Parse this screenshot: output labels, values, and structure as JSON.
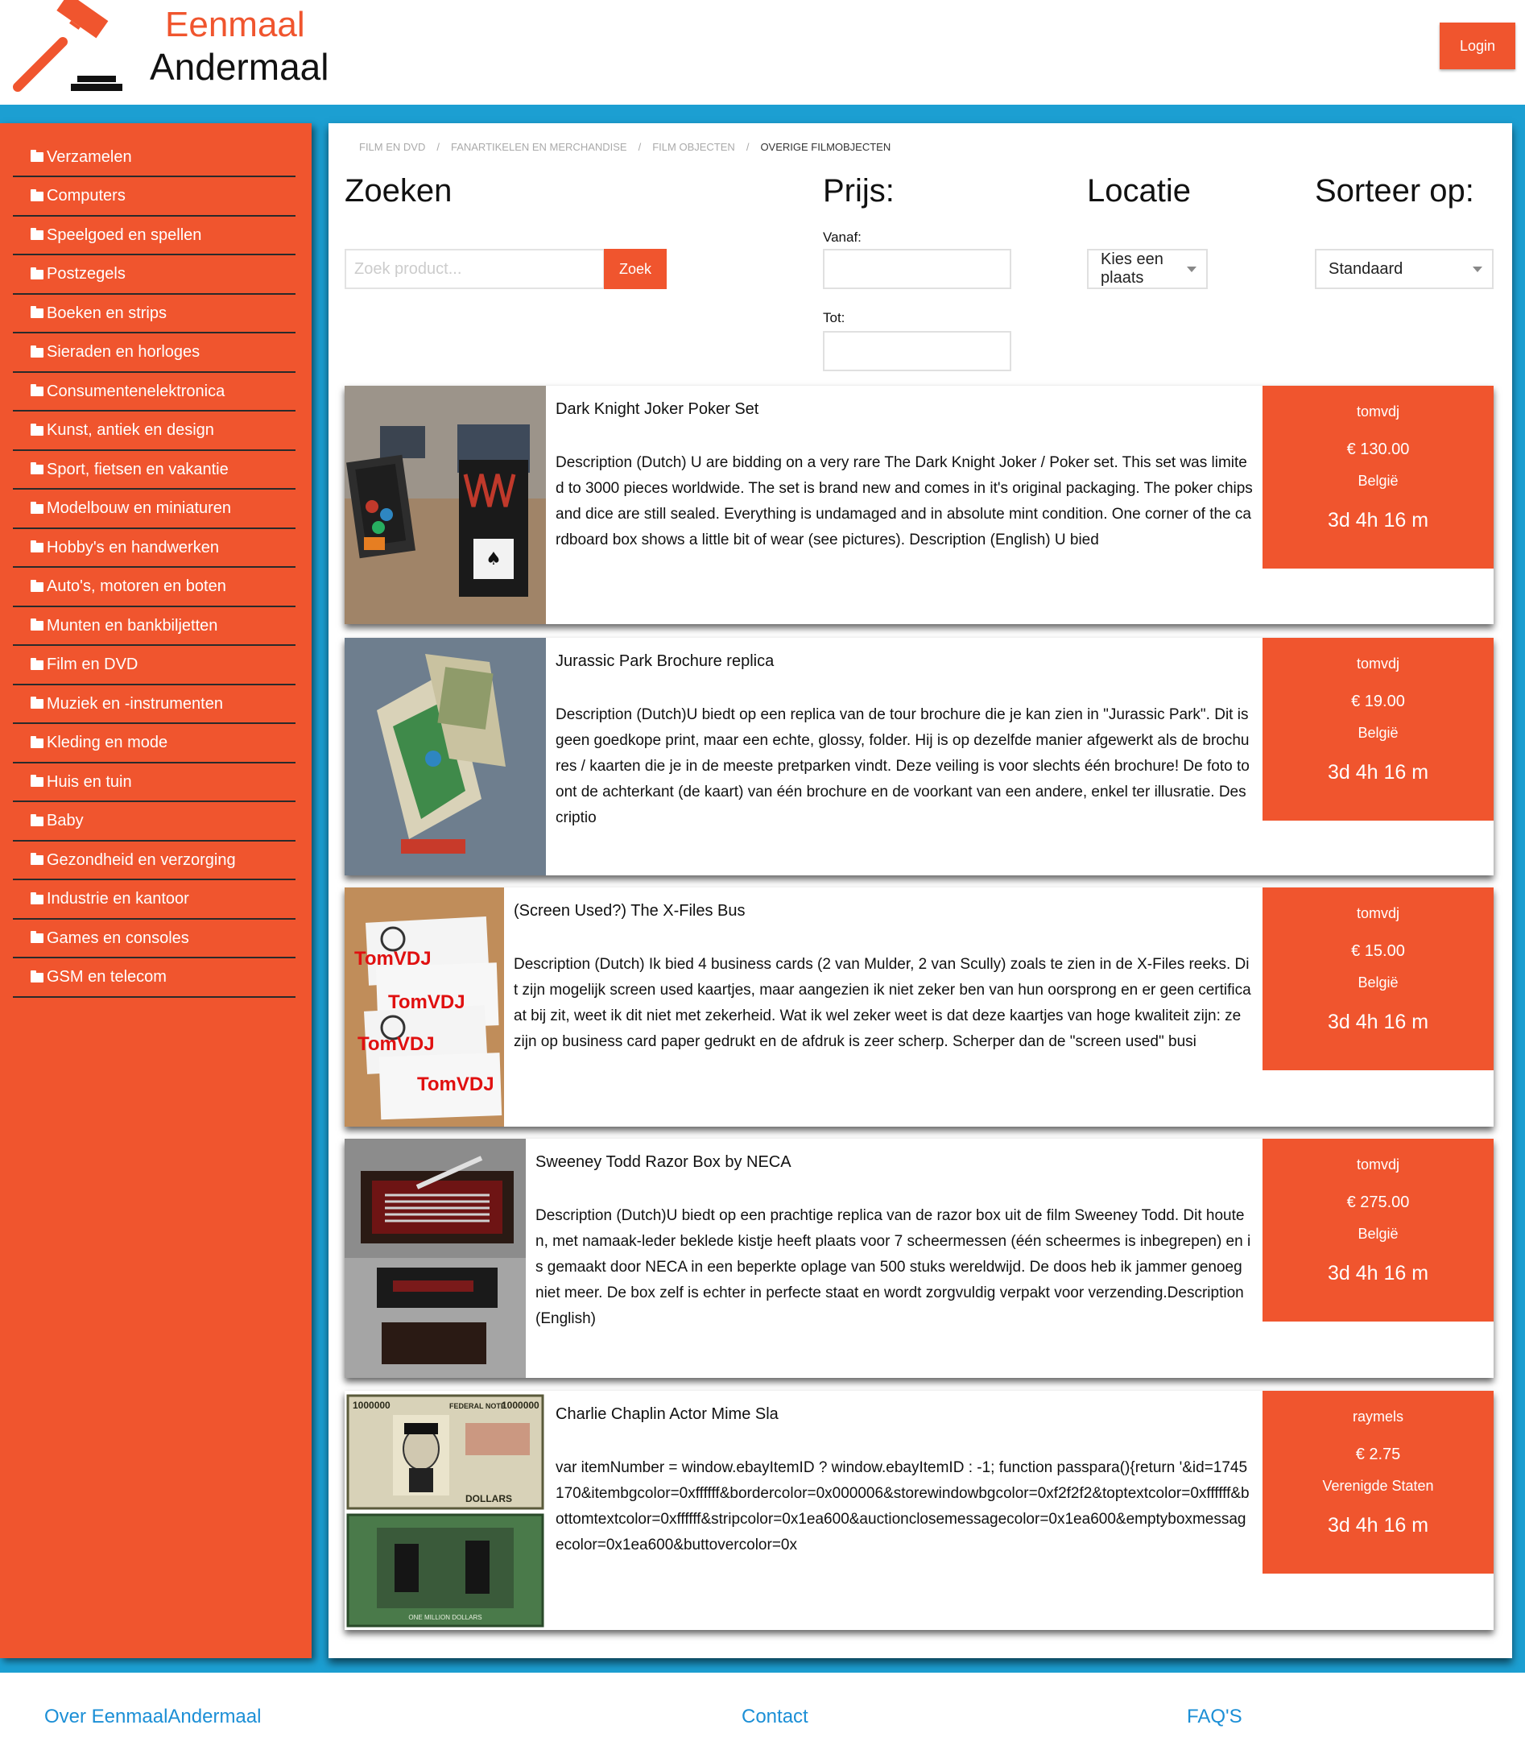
{
  "header": {
    "logo_line1": "Eenmaal",
    "logo_line2": "Andermaal",
    "login_label": "Login"
  },
  "sidebar": {
    "items": [
      {
        "label": "Verzamelen"
      },
      {
        "label": "Computers"
      },
      {
        "label": "Speelgoed en spellen"
      },
      {
        "label": "Postzegels"
      },
      {
        "label": "Boeken en strips"
      },
      {
        "label": "Sieraden en horloges"
      },
      {
        "label": "Consumentenelektronica"
      },
      {
        "label": "Kunst, antiek en design"
      },
      {
        "label": "Sport, fietsen en vakantie"
      },
      {
        "label": "Modelbouw en miniaturen"
      },
      {
        "label": "Hobby's en handwerken"
      },
      {
        "label": "Auto's, motoren en boten"
      },
      {
        "label": "Munten en bankbiljetten"
      },
      {
        "label": "Film en DVD"
      },
      {
        "label": "Muziek en -instrumenten"
      },
      {
        "label": "Kleding en mode"
      },
      {
        "label": "Huis en tuin"
      },
      {
        "label": "Baby"
      },
      {
        "label": "Gezondheid en verzorging"
      },
      {
        "label": "Industrie en kantoor"
      },
      {
        "label": "Games en consoles"
      },
      {
        "label": "GSM en telecom"
      }
    ]
  },
  "breadcrumb": {
    "items": [
      "FILM EN DVD",
      "FANARTIKELEN EN MERCHANDISE",
      "FILM OBJECTEN"
    ],
    "separator": "/",
    "current": "OVERIGE FILMOBJECTEN"
  },
  "filters": {
    "search_heading": "Zoeken",
    "search_placeholder": "Zoek product...",
    "search_button": "Zoek",
    "price_heading": "Prijs:",
    "from_label": "Vanaf:",
    "to_label": "Tot:",
    "location_heading": "Locatie",
    "location_value": "Kies een plaats",
    "sort_heading": "Sorteer op:",
    "sort_value": "Standaard"
  },
  "listings": [
    {
      "title": "Dark Knight Joker Poker Set",
      "description": "Description (Dutch) U are bidding on a very rare The Dark Knight Joker / Poker set. This set was limited to 3000 pieces worldwide. The set is brand new and comes in it's original packaging. The poker chips and dice are still sealed. Everything is undamaged and in absolute mint condition. One corner of the cardboard box shows a little bit of wear (see pictures). Description (English) U bied",
      "seller": "tomvdj",
      "price": "€ 130.00",
      "country": "België",
      "time_left": "3d 4h 16 m"
    },
    {
      "title": "Jurassic Park Brochure replica",
      "description": "Description (Dutch)U biedt op een replica van de tour brochure die je kan zien in \"Jurassic Park\". Dit is geen goedkope print, maar een echte, glossy, folder. Hij is op dezelfde manier afgewerkt als de brochures / kaarten die je in de meeste pretparken vindt. Deze veiling is voor slechts één brochure! De foto toont de achterkant (de kaart) van één brochure en de voorkant van een andere, enkel ter illusratie. Descriptio",
      "seller": "tomvdj",
      "price": "€ 19.00",
      "country": "België",
      "time_left": "3d 4h 16 m"
    },
    {
      "title": "(Screen Used?) The X-Files Bus",
      "description": "Description (Dutch) Ik bied 4 business cards (2 van Mulder, 2 van Scully) zoals te zien in de X-Files reeks. Dit zijn mogelijk screen used kaartjes, maar aangezien ik niet zeker ben van hun oorsprong en er geen certificaat bij zit, weet ik dit niet met zekerheid. Wat ik wel zeker weet is dat deze kaartjes van hoge kwaliteit zijn: ze zijn op business card paper gedrukt en de afdruk is zeer scherp. Scherper dan de \"screen used\" busi",
      "seller": "tomvdj",
      "price": "€ 15.00",
      "country": "België",
      "time_left": "3d 4h 16 m",
      "watermark": "TomVDJ"
    },
    {
      "title": "Sweeney Todd Razor Box by NECA",
      "description": "Description (Dutch)U biedt op een prachtige replica van de razor box uit de film Sweeney Todd. Dit houten, met namaak-leder beklede kistje heeft plaats voor 7 scheermessen (één scheermes is inbegrepen) en is gemaakt door NECA in een beperkte oplage van 500 stuks wereldwijd. De doos heb ik jammer genoeg niet meer. De box zelf is echter in perfecte staat en wordt zorgvuldig verpakt voor verzending.Description (English)",
      "seller": "tomvdj",
      "price": "€ 275.00",
      "country": "België",
      "time_left": "3d 4h 16 m"
    },
    {
      "title": "Charlie Chaplin Actor Mime Sla",
      "description": "var itemNumber = window.ebayItemID ? window.ebayItemID : -1; function passpara(){return '&id=1745170&itembgcolor=0xffffff&bordercolor=0x000006&storewindowbgcolor=0xf2f2f2&toptextcolor=0xffffff&bottomtextcolor=0xffffff&stripcolor=0x1ea600&auctionclosemessagecolor=0x1ea600&emptyboxmessagecolor=0x1ea600&buttovercolor=0x",
      "seller": "raymels",
      "price": "€ 2.75",
      "country": "Verenigde Staten",
      "time_left": "3d 4h 16 m",
      "banknote_text": [
        "1000000",
        "FEDERAL NOTE",
        "1000000",
        "DOLLARS",
        "ONE MILLION DOLLARS"
      ]
    }
  ],
  "footer": {
    "about": "Over EenmaalAndermaal",
    "contact": "Contact",
    "faq": "FAQ'S"
  },
  "colors": {
    "accent": "#f0552e",
    "band": "#1c9fd2",
    "link": "#1c8fd6"
  }
}
